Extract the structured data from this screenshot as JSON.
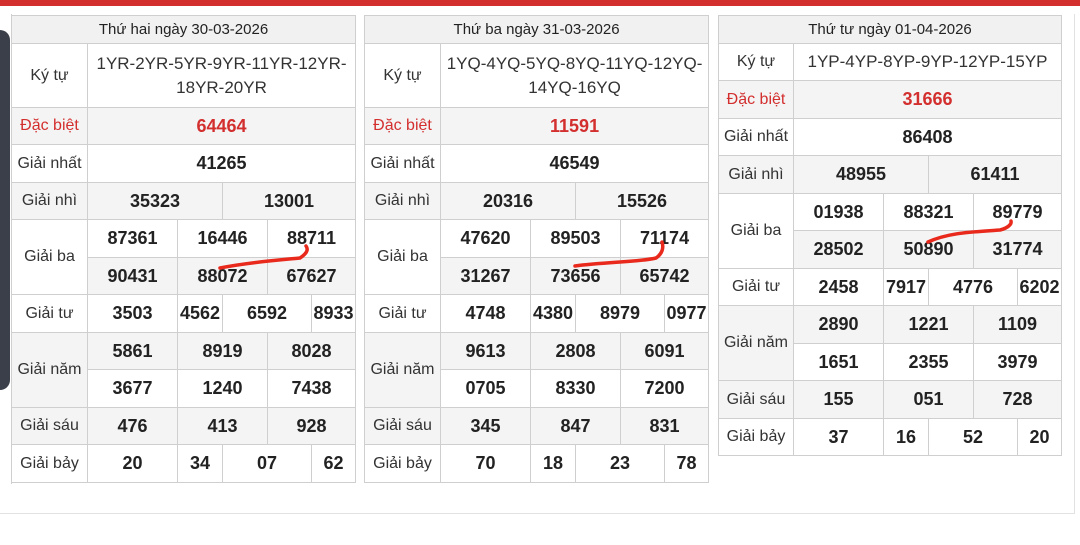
{
  "colors": {
    "accent": "#d32f2f",
    "border": "#cfcfcf",
    "scribble": "#e8291c"
  },
  "tables": [
    {
      "header": "Thứ hai ngày 30-03-2026",
      "code_label": "Ký tự",
      "code_line1": "1YR-2YR-5YR-9YR-11YR-12YR-",
      "code_line2": "18YR-20YR",
      "labels": {
        "db": "Đặc biệt",
        "g1": "Giải nhất",
        "g2": "Giải nhì",
        "g3": "Giải ba",
        "g4": "Giải tư",
        "g5": "Giải năm",
        "g6": "Giải sáu",
        "g7": "Giải bảy"
      },
      "db": "64464",
      "g1": "41265",
      "g2": [
        "35323",
        "13001"
      ],
      "g3": [
        "87361",
        "16446",
        "88711",
        "90431",
        "88072",
        "67627"
      ],
      "g4": [
        "3503",
        "4562",
        "6592",
        "8933"
      ],
      "g5": [
        "5861",
        "8919",
        "8028",
        "3677",
        "1240",
        "7438"
      ],
      "g6": [
        "476",
        "413",
        "928"
      ],
      "g7": [
        "20",
        "34",
        "07",
        "62"
      ]
    },
    {
      "header": "Thứ ba ngày 31-03-2026",
      "code_label": "Ký tự",
      "code_line1": "1YQ-4YQ-5YQ-8YQ-11YQ-12YQ-",
      "code_line2": "14YQ-16YQ",
      "labels": {
        "db": "Đặc biệt",
        "g1": "Giải nhất",
        "g2": "Giải nhì",
        "g3": "Giải ba",
        "g4": "Giải tư",
        "g5": "Giải năm",
        "g6": "Giải sáu",
        "g7": "Giải bảy"
      },
      "db": "11591",
      "g1": "46549",
      "g2": [
        "20316",
        "15526"
      ],
      "g3": [
        "47620",
        "89503",
        "71174",
        "31267",
        "73656",
        "65742"
      ],
      "g4": [
        "4748",
        "4380",
        "8979",
        "0977"
      ],
      "g5": [
        "9613",
        "2808",
        "6091",
        "0705",
        "8330",
        "7200"
      ],
      "g6": [
        "345",
        "847",
        "831"
      ],
      "g7": [
        "70",
        "18",
        "23",
        "78"
      ]
    },
    {
      "header": "Thứ tư ngày 01-04-2026",
      "code_label": "Ký tự",
      "code_line1": "1YP-4YP-8YP-9YP-12YP-15YP",
      "labels": {
        "db": "Đặc biệt",
        "g1": "Giải nhất",
        "g2": "Giải nhì",
        "g3": "Giải ba",
        "g4": "Giải tư",
        "g5": "Giải năm",
        "g6": "Giải sáu",
        "g7": "Giải bảy"
      },
      "db": "31666",
      "g1": "86408",
      "g2": [
        "48955",
        "61411"
      ],
      "g3": [
        "01938",
        "88321",
        "89779",
        "28502",
        "50890",
        "31774"
      ],
      "g4": [
        "2458",
        "7917",
        "4776",
        "6202"
      ],
      "g5": [
        "2890",
        "1221",
        "1109",
        "1651",
        "2355",
        "3979"
      ],
      "g6": [
        "155",
        "051",
        "728"
      ],
      "g7": [
        "37",
        "16",
        "52",
        "20"
      ]
    }
  ]
}
